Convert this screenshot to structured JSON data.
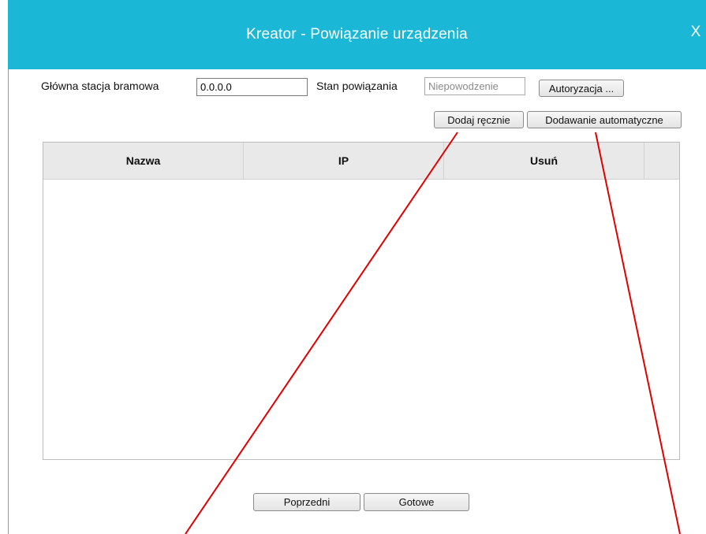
{
  "window": {
    "title": "Kreator - Powiązanie urządzenia",
    "close_label": "X",
    "accent_color": "#1ab8d6"
  },
  "form": {
    "gateway_label": "Główna stacja bramowa",
    "gateway_value": "0.0.0.0",
    "binding_status_label": "Stan powiązania",
    "binding_status_value": "Niepowodzenie",
    "authorize_button": "Autoryzacja ...",
    "add_manual_button": "Dodaj ręcznie",
    "add_auto_button": "Dodawanie automatyczne"
  },
  "table": {
    "columns": [
      "Nazwa",
      "IP",
      "Usuń",
      ""
    ],
    "rows": []
  },
  "footer": {
    "prev_button": "Poprzedni",
    "done_button": "Gotowe"
  },
  "annotation_color": "#e00000"
}
